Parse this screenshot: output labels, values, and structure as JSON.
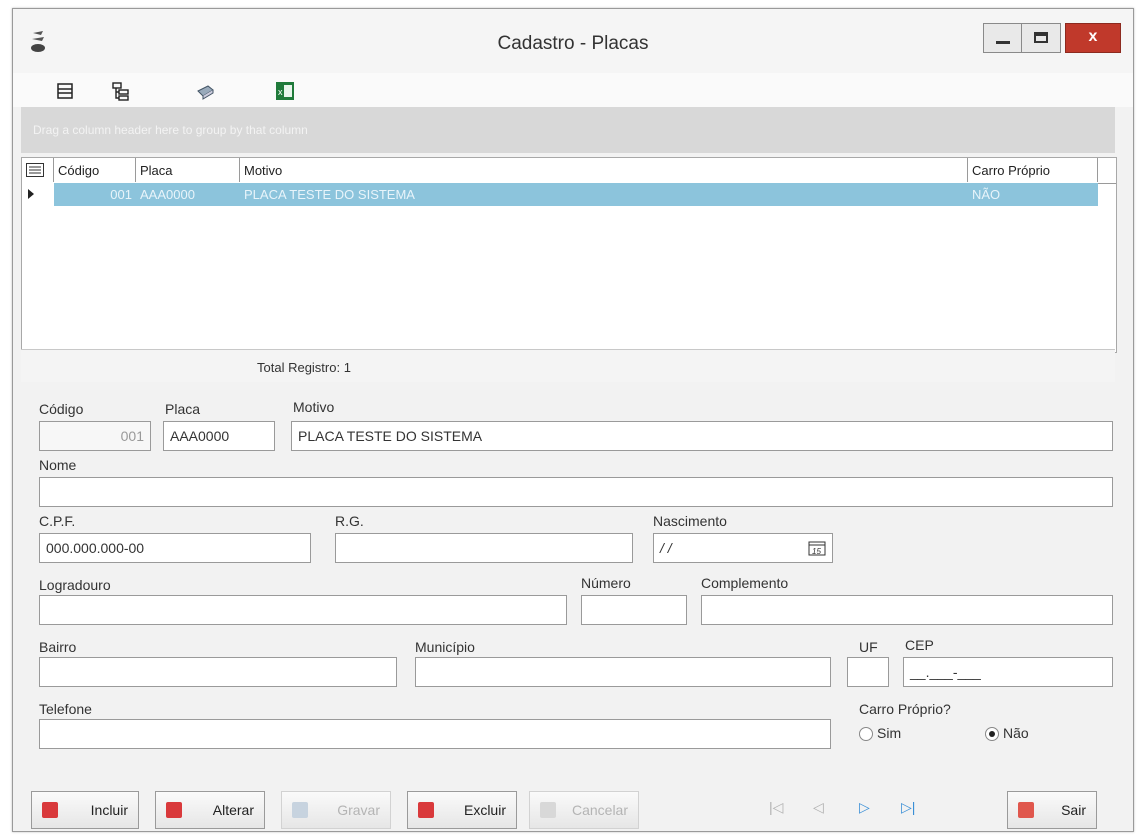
{
  "window": {
    "title": "Cadastro - Placas",
    "close_label": "x"
  },
  "grid": {
    "group_hint": "Drag a column header here to group by that column",
    "columns": [
      "Código",
      "Placa",
      "Motivo",
      "Carro Próprio"
    ],
    "rows": [
      {
        "codigo": "001",
        "placa": "AAA0000",
        "motivo": "PLACA TESTE DO SISTEMA",
        "carro_proprio": "NÃO"
      }
    ],
    "footer": "Total Registro: 1"
  },
  "form": {
    "codigo": {
      "label": "Código",
      "value": "001"
    },
    "placa": {
      "label": "Placa",
      "value": "AAA0000"
    },
    "motivo": {
      "label": "Motivo",
      "value": "PLACA TESTE DO SISTEMA"
    },
    "nome": {
      "label": "Nome",
      "value": ""
    },
    "cpf": {
      "label": "C.P.F.",
      "value": "000.000.000-00"
    },
    "rg": {
      "label": "R.G.",
      "value": ""
    },
    "nascimento": {
      "label": "Nascimento",
      "value": "/ /"
    },
    "logradouro": {
      "label": "Logradouro",
      "value": ""
    },
    "numero": {
      "label": "Número",
      "value": ""
    },
    "complemento": {
      "label": "Complemento",
      "value": ""
    },
    "bairro": {
      "label": "Bairro",
      "value": ""
    },
    "municipio": {
      "label": "Município",
      "value": ""
    },
    "uf": {
      "label": "UF",
      "value": ""
    },
    "cep": {
      "label": "CEP",
      "value": "__.___-___"
    },
    "telefone": {
      "label": "Telefone",
      "value": ""
    },
    "carro_proprio": {
      "label": "Carro Próprio?",
      "options": [
        "Sim",
        "Não"
      ],
      "selected": "Não"
    }
  },
  "buttons": {
    "incluir": "Incluir",
    "alterar": "Alterar",
    "gravar": "Gravar",
    "excluir": "Excluir",
    "cancelar": "Cancelar",
    "sair": "Sair"
  },
  "nav": {
    "first": "|◁",
    "prev": "◁",
    "next": "▷",
    "last": "▷|"
  },
  "colors": {
    "selection": "#8cc4dc",
    "close": "#c0392b",
    "incluir": "#d9393b",
    "alterar": "#d9393b",
    "excluir": "#d9393b",
    "sair": "#e0574d",
    "nav_active": "#3a8fd6"
  },
  "icons": [
    "app-icon",
    "grid-icon",
    "tree-icon",
    "print-icon",
    "excel-icon",
    "calendar-icon"
  ]
}
